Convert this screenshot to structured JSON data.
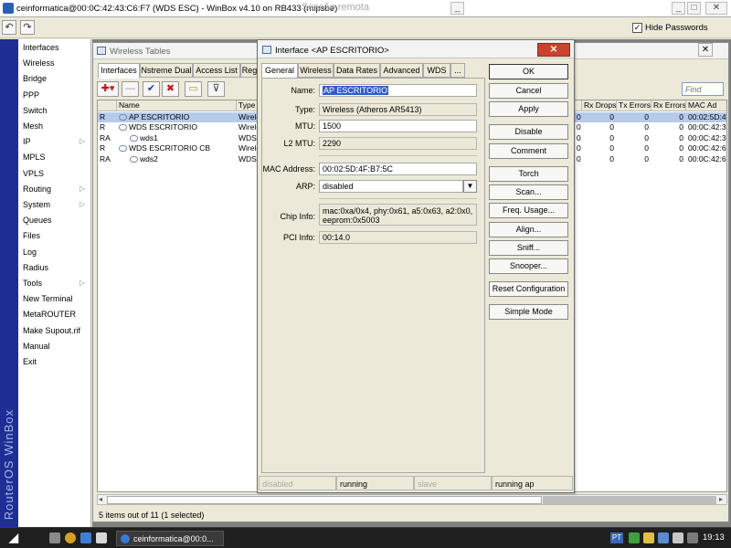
{
  "window": {
    "title": "ceinformatica@00:0C:42:43:C6:F7 (WDS ESC) - WinBox v4.10 on RB433 (mipsbe)",
    "remote_overlay": "Sessão remota",
    "min_glyph": "_",
    "restore_glyph": "□",
    "close_glyph": "✕"
  },
  "toolbar": {
    "undo_glyph": "↶",
    "redo_glyph": "↷",
    "hide_passwords_label": "Hide Passwords",
    "hide_passwords_checked": true,
    "check_glyph": "✓"
  },
  "brand": "RouterOS WinBox",
  "menu": [
    {
      "label": "Interfaces",
      "submenu": false
    },
    {
      "label": "Wireless",
      "submenu": false
    },
    {
      "label": "Bridge",
      "submenu": false
    },
    {
      "label": "PPP",
      "submenu": false
    },
    {
      "label": "Switch",
      "submenu": false
    },
    {
      "label": "Mesh",
      "submenu": false
    },
    {
      "label": "IP",
      "submenu": true
    },
    {
      "label": "MPLS",
      "submenu": false
    },
    {
      "label": "VPLS",
      "submenu": false
    },
    {
      "label": "Routing",
      "submenu": true
    },
    {
      "label": "System",
      "submenu": true
    },
    {
      "label": "Queues",
      "submenu": false
    },
    {
      "label": "Files",
      "submenu": false
    },
    {
      "label": "Log",
      "submenu": false
    },
    {
      "label": "Radius",
      "submenu": false
    },
    {
      "label": "Tools",
      "submenu": true
    },
    {
      "label": "New Terminal",
      "submenu": false
    },
    {
      "label": "MetaROUTER",
      "submenu": false
    },
    {
      "label": "Make Supout.rif",
      "submenu": false
    },
    {
      "label": "Manual",
      "submenu": false
    },
    {
      "label": "Exit",
      "submenu": false
    }
  ],
  "menu_arrow": "▷",
  "wireless_tables": {
    "title": "Wireless Tables",
    "close_glyph": "✕",
    "tabs": [
      "Interfaces",
      "Nstreme Dual",
      "Access List",
      "Reg"
    ],
    "active_tab": 0,
    "buttons": {
      "add": "✚▾",
      "remove": "—",
      "enable": "✔",
      "disable": "✖",
      "comment": "▭",
      "filter": "⊽"
    },
    "find_placeholder": "Find",
    "columns": [
      "",
      "Name",
      "Type",
      "Rx Drops",
      "Tx Errors",
      "Rx Errors",
      "MAC Ad"
    ],
    "rows": [
      {
        "flag": "R",
        "name": "AP ESCRITORIO",
        "type": "Wirele",
        "clip": "0",
        "rx_drops": "0",
        "tx_errors": "0",
        "rx_errors": "0",
        "mac": "00:02:5D:4",
        "selected": true,
        "icon": true,
        "indent": false
      },
      {
        "flag": "R",
        "name": "WDS ESCRITORIO",
        "type": "Wirele",
        "clip": "0",
        "rx_drops": "0",
        "tx_errors": "0",
        "rx_errors": "0",
        "mac": "00:0C:42:3",
        "selected": false,
        "icon": true,
        "indent": false
      },
      {
        "flag": "RA",
        "name": "wds1",
        "type": "WDS",
        "clip": "0",
        "rx_drops": "0",
        "tx_errors": "0",
        "rx_errors": "0",
        "mac": "00:0C:42:3",
        "selected": false,
        "icon": true,
        "indent": true
      },
      {
        "flag": "R",
        "name": "WDS ESCRITORIO CB",
        "type": "Wirele",
        "clip": "0",
        "rx_drops": "0",
        "tx_errors": "0",
        "rx_errors": "0",
        "mac": "00:0C:42:6",
        "selected": false,
        "icon": true,
        "indent": false
      },
      {
        "flag": "RA",
        "name": "wds2",
        "type": "WDS",
        "clip": "0",
        "rx_drops": "0",
        "tx_errors": "0",
        "rx_errors": "0",
        "mac": "00:0C:42:6",
        "selected": false,
        "icon": true,
        "indent": true
      }
    ],
    "status": "5 items out of 11 (1 selected)",
    "scroll_left": "◂",
    "scroll_right": "▸"
  },
  "dialog": {
    "title": "Interface <AP ESCRITORIO>",
    "close_glyph": "✕",
    "tabs": [
      "General",
      "Wireless",
      "Data Rates",
      "Advanced",
      "WDS",
      "..."
    ],
    "active_tab": 0,
    "fields": {
      "name": {
        "label": "Name:",
        "value": "AP ESCRITORIO"
      },
      "type": {
        "label": "Type:",
        "value": "Wireless (Atheros AR5413)"
      },
      "mtu": {
        "label": "MTU:",
        "value": "1500"
      },
      "l2mtu": {
        "label": "L2 MTU:",
        "value": "2290"
      },
      "mac": {
        "label": "MAC Address:",
        "value": "00:02:5D:4F:B7:5C"
      },
      "arp": {
        "label": "ARP:",
        "value": "disabled"
      },
      "chip": {
        "label": "Chip Info:",
        "line1": "mac:0xa/0x4, phy:0x61, a5:0x63, a2:0x0,",
        "line2": "eeprom:0x5003"
      },
      "pci": {
        "label": "PCI Info:",
        "value": "00:14.0"
      }
    },
    "dropdown_glyph": "▼",
    "buttons": [
      "OK",
      "Cancel",
      "Apply",
      "Disable",
      "Comment",
      "Torch",
      "Scan...",
      "Freq. Usage...",
      "Align...",
      "Sniff...",
      "Snooper...",
      "Reset Configuration",
      "Simple Mode"
    ],
    "status": [
      "disabled",
      "running",
      "slave",
      "running ap"
    ]
  },
  "taskbar": {
    "start_glyph": "◢",
    "task_label": "ceinformatica@00:0...",
    "lang": "PT",
    "clock": "19:13"
  }
}
